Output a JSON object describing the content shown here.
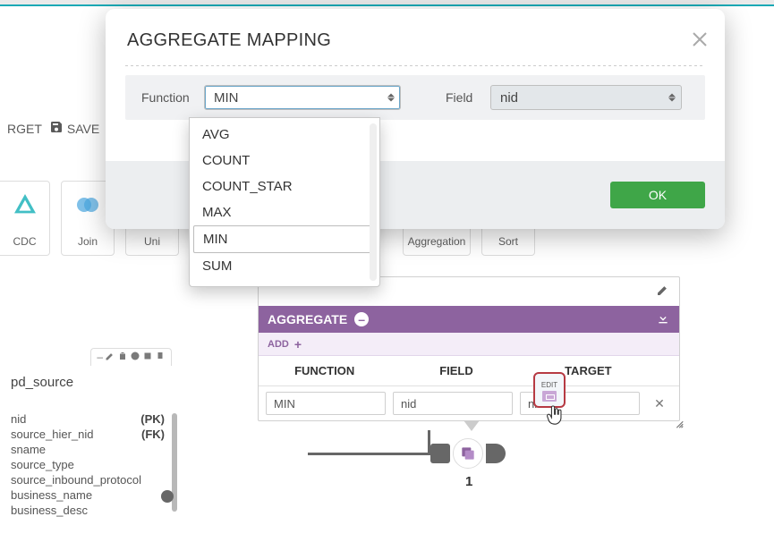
{
  "modal": {
    "title": "AGGREGATE MAPPING",
    "function_label": "Function",
    "function_value": "MIN",
    "field_label": "Field",
    "field_value": "nid",
    "ok_label": "OK",
    "options": [
      "AVG",
      "COUNT",
      "COUNT_STAR",
      "MAX",
      "MIN",
      "SUM"
    ],
    "selected_option": "MIN"
  },
  "toolbar": {
    "target_label": "RGET",
    "save_label": "SAVE"
  },
  "tiles": {
    "cdc": "CDC",
    "join": "Join",
    "union": "Uni",
    "aggregation": "Aggregation",
    "sort": "Sort"
  },
  "schema": {
    "title": "pd_source",
    "rows": [
      {
        "name": "nid",
        "key": "(PK)"
      },
      {
        "name": "source_hier_nid",
        "key": "(FK)"
      },
      {
        "name": "sname",
        "key": ""
      },
      {
        "name": "source_type",
        "key": ""
      },
      {
        "name": "source_inbound_protocol",
        "key": ""
      },
      {
        "name": "business_name",
        "key": ""
      },
      {
        "name": "business_desc",
        "key": ""
      }
    ]
  },
  "aggregate": {
    "header": "AGGREGATE",
    "add_label": "ADD",
    "columns": {
      "function": "FUNCTION",
      "field": "FIELD",
      "target": "TARGET"
    },
    "row": {
      "function": "MIN",
      "field": "nid",
      "target": "nid"
    },
    "edit_tag": "EDIT",
    "flow_label": "1"
  }
}
